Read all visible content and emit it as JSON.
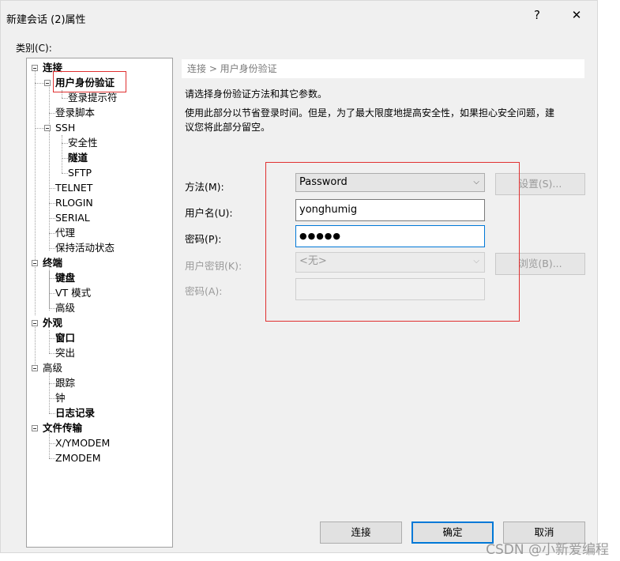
{
  "window": {
    "title": "新建会话 (2)属性",
    "help_button": "?",
    "close_button": "✕"
  },
  "category_label": "类别(C):",
  "tree": [
    {
      "label": "连接",
      "bold": true,
      "expanded": true
    },
    {
      "label": "用户身份验证",
      "bold": true,
      "expanded": true,
      "selected": true
    },
    {
      "label": "登录提示符",
      "bold": false
    },
    {
      "label": "登录脚本",
      "bold": false
    },
    {
      "label": "SSH",
      "bold": false,
      "expanded": true
    },
    {
      "label": "安全性",
      "bold": false
    },
    {
      "label": "隧道",
      "bold": true
    },
    {
      "label": "SFTP",
      "bold": false
    },
    {
      "label": "TELNET",
      "bold": false
    },
    {
      "label": "RLOGIN",
      "bold": false
    },
    {
      "label": "SERIAL",
      "bold": false
    },
    {
      "label": "代理",
      "bold": false
    },
    {
      "label": "保持活动状态",
      "bold": false
    },
    {
      "label": "终端",
      "bold": true,
      "expanded": true
    },
    {
      "label": "键盘",
      "bold": true
    },
    {
      "label": "VT 模式",
      "bold": false
    },
    {
      "label": "高级",
      "bold": false
    },
    {
      "label": "外观",
      "bold": true,
      "expanded": true
    },
    {
      "label": "窗口",
      "bold": true
    },
    {
      "label": "突出",
      "bold": false
    },
    {
      "label": "高级",
      "bold": false,
      "expanded": true
    },
    {
      "label": "跟踪",
      "bold": false
    },
    {
      "label": "钟",
      "bold": false
    },
    {
      "label": "日志记录",
      "bold": true
    },
    {
      "label": "文件传输",
      "bold": true,
      "expanded": true
    },
    {
      "label": "X/YMODEM",
      "bold": false
    },
    {
      "label": "ZMODEM",
      "bold": false
    }
  ],
  "breadcrumb": "连接 > 用户身份验证",
  "description": {
    "line1": "请选择身份验证方法和其它参数。",
    "line2a": "使用此部分以节省登录时间。但是，为了最大限度地提高安全性，如果担心安全问题，建",
    "line2b": "议您将此部分留空。"
  },
  "form": {
    "method_label": "方法(M):",
    "method_value": "Password",
    "settings_button": "设置(S)...",
    "username_label": "用户名(U):",
    "username_value": "yonghumig",
    "password_label": "密码(P):",
    "password_value": "●●●●●",
    "userkey_label": "用户密钥(K):",
    "userkey_value": "<无>",
    "browse_button": "浏览(B)...",
    "passphrase_label": "密码(A):",
    "passphrase_value": ""
  },
  "footer": {
    "connect_button": "连接",
    "ok_button": "确定",
    "cancel_button": "取消"
  },
  "watermark": "CSDN @小新爱编程",
  "colors": {
    "highlight_box": "#e03030",
    "focus_border": "#0078d7"
  }
}
